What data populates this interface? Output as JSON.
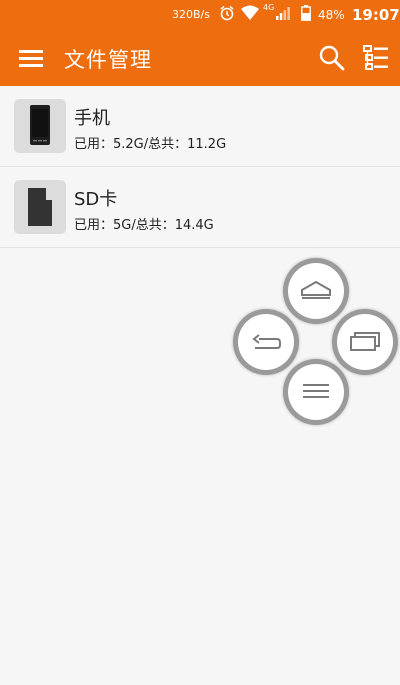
{
  "status_bar": {
    "net_speed": "320B/s",
    "network_type": "4G",
    "battery": "48%",
    "time": "19:07",
    "icons": [
      "alarm-icon",
      "wifi-icon",
      "signal-icon",
      "battery-icon"
    ]
  },
  "app_bar": {
    "title": "文件管理",
    "icons": [
      "menu-icon",
      "search-icon",
      "list-view-icon"
    ],
    "color": "#ee6d0e"
  },
  "storage": [
    {
      "name": "手机",
      "usage": "已用：5.2G/总共：11.2G",
      "icon": "phone-icon"
    },
    {
      "name": "SD卡",
      "usage": "已用：5G/总共：14.4G",
      "icon": "sd-card-icon"
    }
  ],
  "floating_menu": {
    "buttons": [
      "home-icon",
      "back-icon",
      "recent-apps-icon",
      "menu-lines-icon"
    ]
  }
}
